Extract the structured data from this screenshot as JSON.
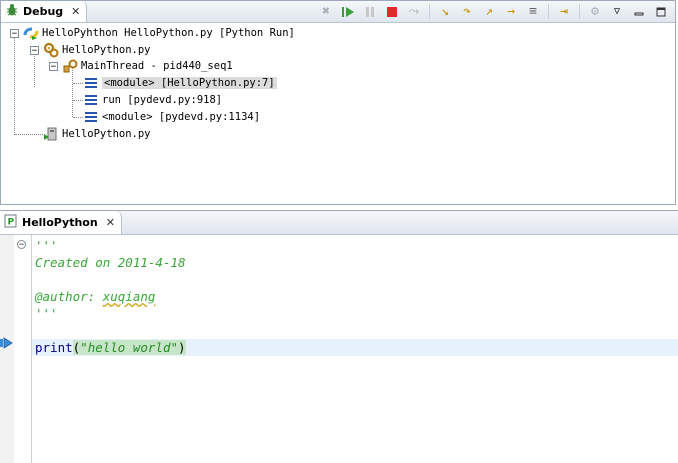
{
  "debug_view": {
    "tab_label": "Debug",
    "tree": [
      {
        "label": "HelloPyhthon HelloPython.py [Python Run]",
        "icon": "python-launch-icon"
      },
      {
        "label": "HelloPython.py",
        "icon": "debug-target-icon"
      },
      {
        "label": "MainThread - pid440_seq1",
        "icon": "thread-icon"
      },
      {
        "label": "<module> [HelloPython.py:7]",
        "icon": "stack-frame-icon",
        "selected": true
      },
      {
        "label": "run [pydevd.py:918]",
        "icon": "stack-frame-icon"
      },
      {
        "label": "<module> [pydevd.py:1134]",
        "icon": "stack-frame-icon"
      },
      {
        "label": "HelloPython.py",
        "icon": "process-icon"
      }
    ],
    "toolbar": [
      "remove-terminated-icon",
      "resume-icon",
      "suspend-icon",
      "terminate-icon",
      "disconnect-icon",
      "step-into-icon",
      "step-over-icon",
      "step-return-icon",
      "drop-to-frame-icon",
      "step-filters-icon",
      "use-step-filters-icon",
      "thread-icon",
      "view-menu-icon",
      "minimize-icon",
      "maximize-icon"
    ]
  },
  "editor": {
    "tab_label": "HelloPython",
    "lines": {
      "l1": "'''",
      "l2": "Created on 2011-4-18",
      "l3": "",
      "l4_prefix": "@author: ",
      "l4_name": "xuqiang",
      "l5": "'''",
      "l6": "",
      "l7_kw": "print",
      "l7_open": "(",
      "l7_str": "\"hello world\"",
      "l7_close": ")"
    }
  },
  "colors": {
    "comment": "#38a838",
    "current_line": "#e8f2fe",
    "bracket_match": "#c7e5c7"
  }
}
